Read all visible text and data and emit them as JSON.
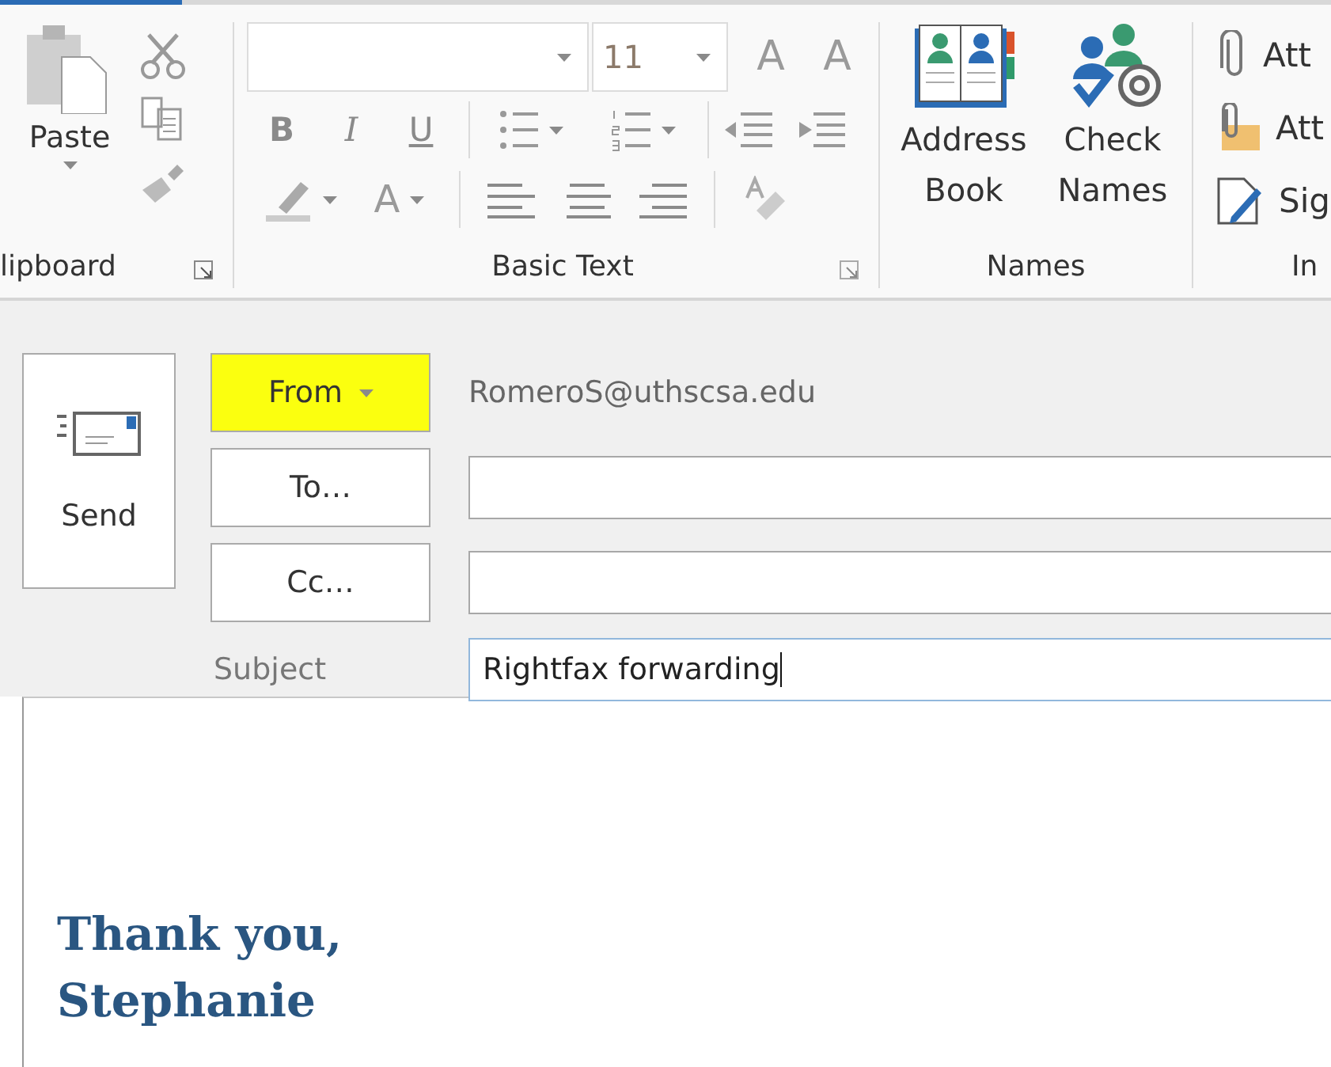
{
  "ribbon": {
    "clipboard": {
      "label": "lipboard",
      "paste": "Paste"
    },
    "basic_text": {
      "label": "Basic Text",
      "font_size": "11",
      "grow": "A",
      "shrink": "A",
      "format_buttons": [
        "B",
        "I",
        "U"
      ],
      "font_color": "A"
    },
    "names": {
      "label": "Names",
      "buttons": [
        "Address Book",
        "Check Names"
      ]
    },
    "include": {
      "label": "In",
      "items": [
        "Att",
        "Att",
        "Sig"
      ]
    }
  },
  "compose": {
    "send": "Send",
    "from": {
      "label": "From",
      "highlighted": true
    },
    "from_address": "RomeroS@uthscsa.edu",
    "to": {
      "label": "To…"
    },
    "cc": {
      "label": "Cc…"
    },
    "subject_label": "Subject",
    "subject_value": "Rightfax forwarding"
  },
  "body": {
    "lines": [
      "Thank you,",
      "Stephanie"
    ]
  }
}
